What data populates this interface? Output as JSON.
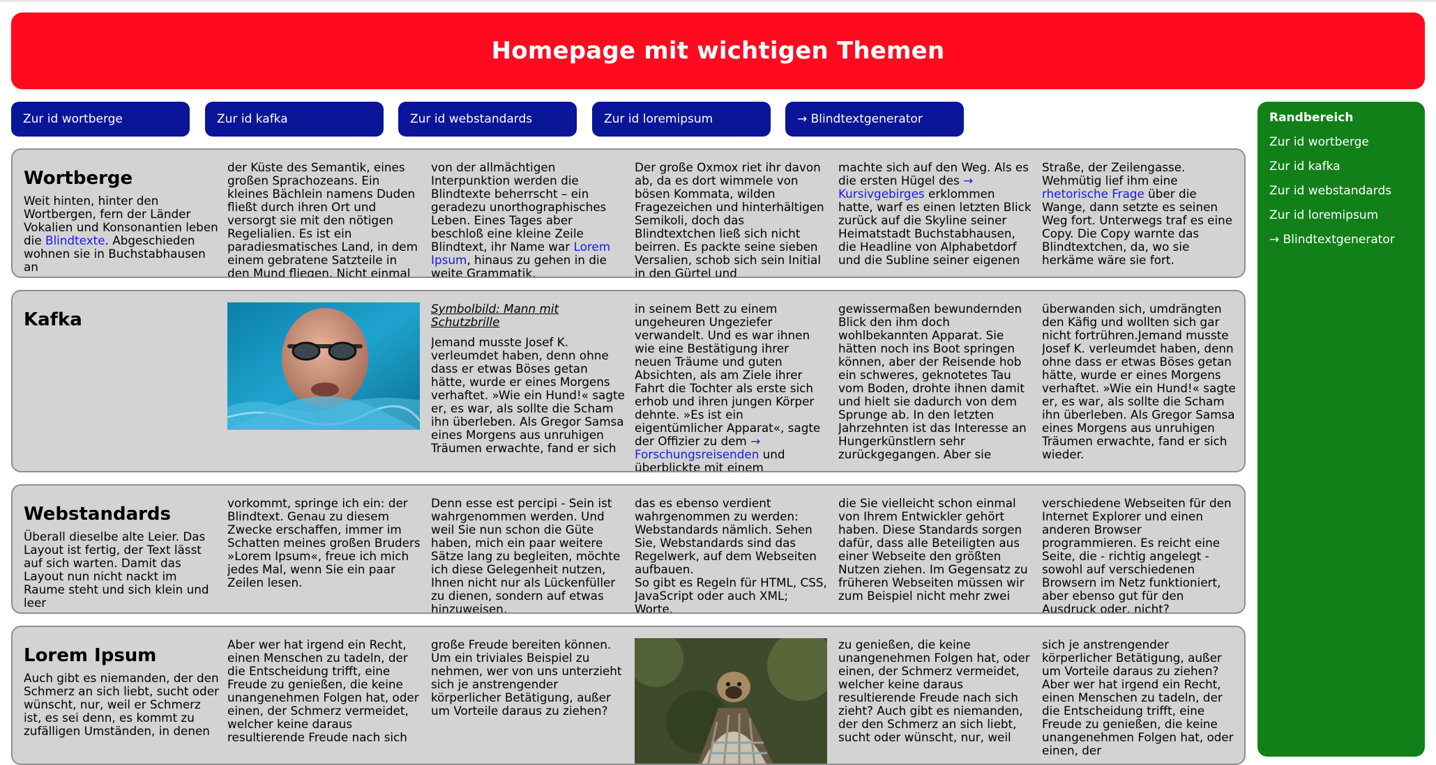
{
  "header": {
    "title": "Homepage mit wichtigen Themen"
  },
  "nav": {
    "items": [
      {
        "label": "Zur id wortberge"
      },
      {
        "label": "Zur id kafka"
      },
      {
        "label": "Zur id webstandards"
      },
      {
        "label": "Zur id loremipsum"
      },
      {
        "label": "→ Blindtextgenerator"
      }
    ]
  },
  "sidebar": {
    "title": "Randbereich",
    "links": [
      {
        "label": "Zur id wortberge"
      },
      {
        "label": "Zur id kafka"
      },
      {
        "label": "Zur id webstandards"
      },
      {
        "label": "Zur id loremipsum"
      },
      {
        "label": "→ Blindtextgenerator"
      }
    ]
  },
  "wortberge": {
    "title": "Wortberge",
    "c1_a": "Weit hinten, hinter den Wortbergen, fern der Länder Vokalien und Konsonantien leben die ",
    "c1_link": "Blindtexte",
    "c1_b": ". Abgeschieden wohnen sie in Buchstabhausen an",
    "c2": "der Küste des Semantik, eines großen Sprachozeans. Ein kleines Bächlein namens Duden fließt durch ihren Ort und versorgt sie mit den nötigen Regelialien. Es ist ein paradiesmatisches Land, in dem einem gebratene Satzteile in den Mund fliegen. Nicht einmal",
    "c3_a": "von der allmächtigen Interpunktion werden die Blindtexte beherrscht – ein geradezu unorthographisches Leben. Eines Tages aber beschloß eine kleine Zeile Blindtext, ihr Name war ",
    "c3_link": "Lorem Ipsum",
    "c3_b": ", hinaus zu gehen in die weite Grammatik.",
    "c4": "Der große Oxmox riet ihr davon ab, da es dort wimmele von bösen Kommata, wilden Fragezeichen und hinterhältigen Semikoli, doch das Blindtextchen ließ sich nicht beirren. Es packte seine sieben Versalien, schob sich sein Initial in den Gürtel und",
    "c5_a": "machte sich auf den Weg. Als es die ersten Hügel des ",
    "c5_link": "→ Kursivgebirges",
    "c5_b": " erklommen hatte, warf es einen letzten Blick zurück auf die Skyline seiner Heimatstadt Buchstabhausen, die Headline von Alphabetdorf und die Subline seiner eigenen",
    "c6_a": "Straße, der Zeilengasse. Wehmütig lief ihm eine ",
    "c6_link": "rhetorische Frage",
    "c6_b": " über die Wange, dann setzte es seinen Weg fort. Unterwegs traf es eine Copy. Die Copy warnte das Blindtextchen, da, wo sie herkäme wäre sie fort."
  },
  "kafka": {
    "title": "Kafka",
    "caption": "Symbolbild: Mann mit Schutzbrille",
    "c3": "Jemand musste Josef K. verleumdet haben, denn ohne dass er etwas Böses getan hätte, wurde er eines Morgens verhaftet. »Wie ein Hund!« sagte er, es war, als sollte die Scham ihn überleben. Als Gregor Samsa eines Morgens aus unruhigen Träumen erwachte, fand er sich",
    "c4_a": "in seinem Bett zu einem ungeheuren Ungeziefer verwandelt. Und es war ihnen wie eine Bestätigung ihrer neuen Träume und guten Absichten, als am Ziele ihrer Fahrt die Tochter als erste sich erhob und ihren jungen Körper dehnte. »Es ist ein eigentümlicher Apparat«, sagte der Offizier zu dem ",
    "c4_link": "→ Forschungsreisenden",
    "c4_b": " und überblickte mit einem",
    "c5": "gewissermaßen bewundernden Blick den ihm doch wohlbekannten Apparat. Sie hätten noch ins Boot springen können, aber der Reisende hob ein schweres, geknotetes Tau vom Boden, drohte ihnen damit und hielt sie dadurch von dem Sprunge ab. In den letzten Jahrzehnten ist das Interesse an Hungerkünstlern sehr zurückgegangen. Aber sie",
    "c6": "überwanden sich, umdrängten den Käfig und wollten sich gar nicht fortrühren.Jemand musste Josef K. verleumdet haben, denn ohne dass er etwas Böses getan hätte, wurde er eines Morgens verhaftet. »Wie ein Hund!« sagte er, es war, als sollte die Scham ihn überleben. Als Gregor Samsa eines Morgens aus unruhigen Träumen erwachte, fand er sich wieder."
  },
  "webstandards": {
    "title": "Webstandards",
    "c1": "Überall dieselbe alte Leier. Das Layout ist fertig, der Text lässt auf sich warten. Damit das Layout nun nicht nackt im Raume steht und sich klein und leer",
    "c2": "vorkommt, springe ich ein: der Blindtext. Genau zu diesem Zwecke erschaffen, immer im Schatten meines großen Bruders »Lorem Ipsum«, freue ich mich jedes Mal, wenn Sie ein paar Zeilen lesen.",
    "c3": "Denn esse est percipi - Sein ist wahrgenommen werden. Und weil Sie nun schon die Güte haben, mich ein paar weitere Sätze lang zu begleiten, möchte ich diese Gelegenheit nutzen, Ihnen nicht nur als Lückenfüller zu dienen, sondern auf etwas hinzuweisen,",
    "c4_a": "das es ebenso verdient wahrgenommen zu werden: Webstandards nämlich. Sehen Sie, Webstandards sind das Regelwerk, auf dem Webseiten aufbauen.",
    "c4_b": "So gibt es Regeln für HTML, CSS, JavaScript oder auch XML; Worte,",
    "c5": "die Sie vielleicht schon einmal von Ihrem Entwickler gehört haben. Diese Standards sorgen dafür, dass alle Beteiligten aus einer Webseite den größten Nutzen ziehen. Im Gegensatz zu früheren Webseiten müssen wir zum Beispiel nicht mehr zwei",
    "c6": "verschiedene Webseiten für den Internet Explorer und einen anderen Browser programmieren. Es reicht eine Seite, die - richtig angelegt - sowohl auf verschiedenen Browsern im Netz funktioniert, aber ebenso gut für den Ausdruck oder, nicht?"
  },
  "loremipsum": {
    "title": "Lorem Ipsum",
    "c1": "Auch gibt es niemanden, der den Schmerz an sich liebt, sucht oder wünscht, nur, weil er Schmerz ist, es sei denn, es kommt zu zufälligen Umständen, in denen",
    "c2": "Aber wer hat irgend ein Recht, einen Menschen zu tadeln, der die Entscheidung trifft, eine Freude zu genießen, die keine unangenehmen Folgen hat, oder einen, der Schmerz vermeidet, welcher keine daraus resultierende Freude nach sich",
    "c3": "große Freude bereiten können. Um ein triviales Beispiel zu nehmen, wer von uns unterzieht sich je anstrengender körperlicher Betätigung, außer um Vorteile daraus zu ziehen?",
    "c5": "zu genießen, die keine unangenehmen Folgen hat, oder einen, der Schmerz vermeidet, welcher keine daraus resultierende Freude nach sich zieht? Auch gibt es niemanden, der den Schmerz an sich liebt, sucht oder wünscht, nur, weil",
    "c6": "sich je anstrengender körperlicher Betätigung, außer um Vorteile daraus zu ziehen? Aber wer hat irgend ein Recht, einen Menschen zu tadeln, der die Entscheidung trifft, eine Freude zu genießen, die keine unangenehmen Folgen hat, oder einen, der"
  },
  "colors": {
    "header_bg": "#ff0a1f",
    "nav_bg": "#0a1598",
    "sidebar_bg": "#118019",
    "card_bg": "#d3d3d3",
    "link": "#1a1ae0"
  }
}
